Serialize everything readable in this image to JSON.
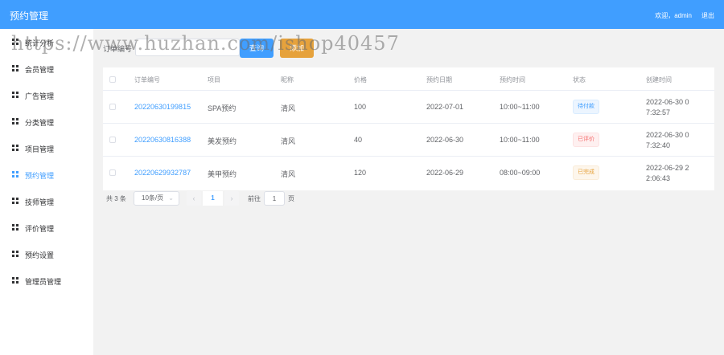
{
  "header": {
    "title": "预约管理",
    "welcome": "欢迎，admin",
    "logout": "退出"
  },
  "sidebar": {
    "items": [
      {
        "label": "统计分析",
        "active": false
      },
      {
        "label": "会员管理",
        "active": false
      },
      {
        "label": "广告管理",
        "active": false
      },
      {
        "label": "分类管理",
        "active": false
      },
      {
        "label": "项目管理",
        "active": false
      },
      {
        "label": "预约管理",
        "active": true
      },
      {
        "label": "技师管理",
        "active": false
      },
      {
        "label": "评价管理",
        "active": false
      },
      {
        "label": "预约设置",
        "active": false
      },
      {
        "label": "管理员管理",
        "active": false
      }
    ]
  },
  "search": {
    "label": "订单编号",
    "placeholder": "",
    "query_button": "查询",
    "add_button": "添加"
  },
  "table": {
    "headers": [
      "订单编号",
      "项目",
      "昵称",
      "价格",
      "预约日期",
      "预约时间",
      "状态",
      "创建时间"
    ],
    "rows": [
      {
        "order_no": "20220630199815",
        "project": "SPA预约",
        "nickname": "清风",
        "price": "100",
        "date": "2022-07-01",
        "time": "10:00~11:00",
        "status": "待付款",
        "status_kind": "pending",
        "created": "2022-06-30 07:32:57"
      },
      {
        "order_no": "20220630816388",
        "project": "美发预约",
        "nickname": "清风",
        "price": "40",
        "date": "2022-06-30",
        "time": "10:00~11:00",
        "status": "已评价",
        "status_kind": "reviewed",
        "created": "2022-06-30 07:32:40"
      },
      {
        "order_no": "20220629932787",
        "project": "美甲预约",
        "nickname": "清风",
        "price": "120",
        "date": "2022-06-29",
        "time": "08:00~09:00",
        "status": "已完成",
        "status_kind": "done",
        "created": "2022-06-29 22:06:43"
      }
    ]
  },
  "pagination": {
    "total": "共 3 条",
    "page_size": "10条/页",
    "current_page": "1",
    "goto_label": "前往",
    "goto_value": "1",
    "page_unit": "页"
  },
  "watermark": "https://www.huzhan.com/ishop40457"
}
